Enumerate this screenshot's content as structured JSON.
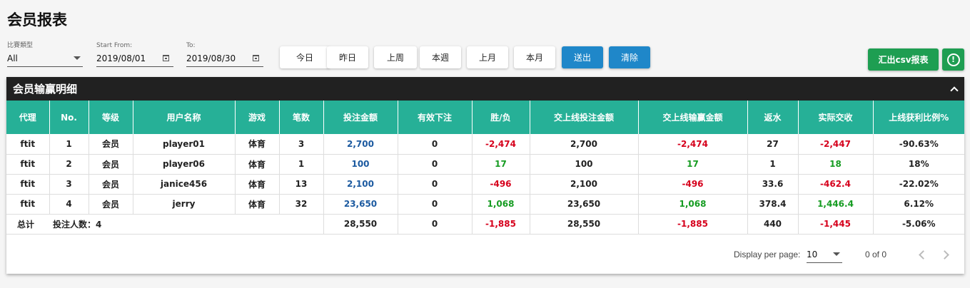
{
  "page": {
    "title": "会员报表"
  },
  "filters": {
    "game_type": {
      "label": "比賽類型",
      "value": "All"
    },
    "start": {
      "label": "Start From:",
      "value": "2019/08/01"
    },
    "end": {
      "label": "To:",
      "value": "2019/08/30"
    }
  },
  "buttons": {
    "today": "今日",
    "yesterday": "昨日",
    "last_week": "上周",
    "this_week": "本週",
    "last_month": "上月",
    "this_month": "本月",
    "submit": "送出",
    "clear": "清除",
    "export": "汇出csv报表",
    "info_icon": "!"
  },
  "section": {
    "title": "会员输赢明细"
  },
  "table": {
    "headers": [
      "代理",
      "No.",
      "等级",
      "用户名称",
      "游戏",
      "笔数",
      "投注金额",
      "有效下注",
      "胜/负",
      "交上线投注金额",
      "交上线输赢金额",
      "返水",
      "实际交收",
      "上线获利比例%"
    ],
    "rows": [
      [
        "ftit",
        "1",
        "会员",
        "player01",
        "体育",
        "3",
        "2,700",
        "0",
        "-2,474",
        "2,700",
        "-2,474",
        "27",
        "-2,447",
        "-90.63%"
      ],
      [
        "ftit",
        "2",
        "会员",
        "player06",
        "体育",
        "1",
        "100",
        "0",
        "17",
        "100",
        "17",
        "1",
        "18",
        "18%"
      ],
      [
        "ftit",
        "3",
        "会员",
        "janice456",
        "体育",
        "13",
        "2,100",
        "0",
        "-496",
        "2,100",
        "-496",
        "33.6",
        "-462.4",
        "-22.02%"
      ],
      [
        "ftit",
        "4",
        "会员",
        "jerry",
        "体育",
        "32",
        "23,650",
        "0",
        "1,068",
        "23,650",
        "1,068",
        "378.4",
        "1,446.4",
        "6.12%"
      ]
    ],
    "totals": {
      "label": "总计",
      "bettors": "投注人数：4",
      "values": [
        "28,550",
        "0",
        "-1,885",
        "28,550",
        "-1,885",
        "440",
        "-1,445",
        "-5.06%"
      ]
    }
  },
  "pagination": {
    "per_page_label": "Display per page:",
    "per_page_value": "10",
    "range": "0 of 0"
  },
  "colors": {
    "header_bg": "#26b097",
    "positive": "#169c22",
    "negative": "#d6001c",
    "amount": "#1c5aa0"
  }
}
